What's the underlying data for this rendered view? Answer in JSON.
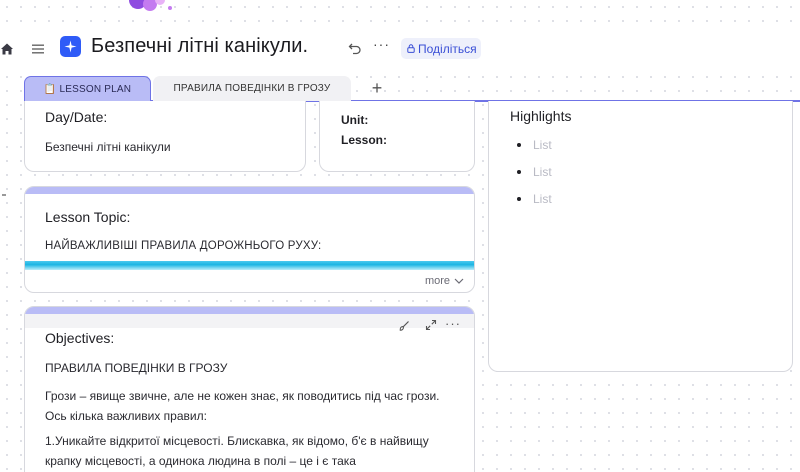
{
  "header": {
    "title": "Безпечні літні канікули.",
    "share_label": "Поділіться",
    "more_label": "···"
  },
  "tabs": [
    {
      "label": "📋 LESSON PLAN",
      "active": true
    },
    {
      "label": "ПРАВИЛА ПОВЕДІНКИ В ГРОЗУ",
      "active": false
    }
  ],
  "add_tab_label": "+",
  "date_card": {
    "label": "Day/Date:",
    "value": "Безпечні літні канікули"
  },
  "unit_card": {
    "unit_label": "Unit:",
    "lesson_label": "Lesson:"
  },
  "topic_card": {
    "label": "Lesson Topic:",
    "value": "НАЙВАЖЛИВІШІ ПРАВИЛА ДОРОЖНЬОГО РУХУ:",
    "more_label": "more"
  },
  "objectives_card": {
    "label": "Objectives:",
    "heading": "ПРАВИЛА ПОВЕДІНКИ В ГРОЗУ",
    "paragraph1": "Грози – явище звичне, але не кожен знає, як поводитись під час грози. Ось кілька важливих правил:",
    "paragraph2": "1.Уникайте відкритої місцевості. Блискавка, як відомо, б'є в найвищу крапку місцевості, а одинока людина в полі – це і є така"
  },
  "highlights_card": {
    "label": "Highlights",
    "items": [
      "List",
      "List",
      "List"
    ]
  },
  "colors": {
    "accent": "#6f73e6",
    "tab_active": "#b9bcf6",
    "logo": "#2f5bf7",
    "stripe": "#1bb5e3"
  }
}
